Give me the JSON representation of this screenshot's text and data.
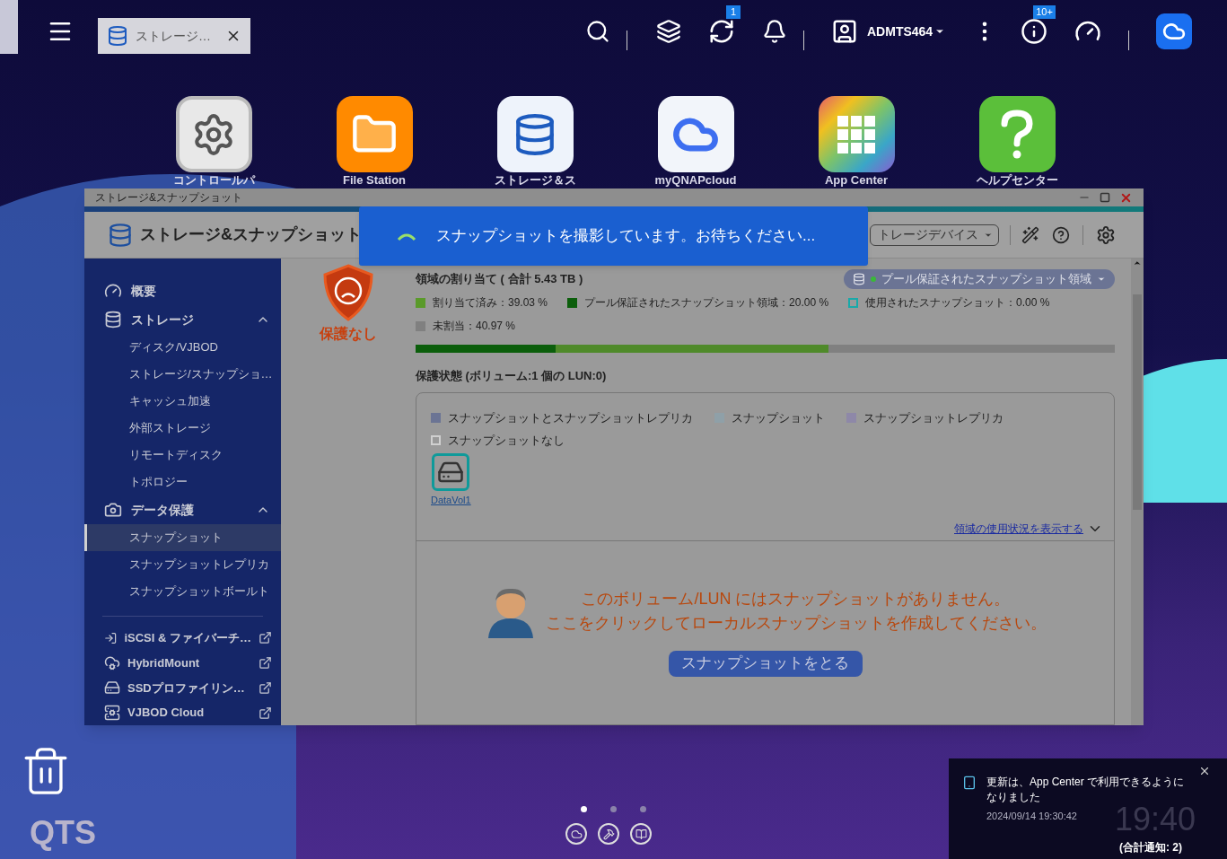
{
  "taskbar": {
    "tab": {
      "label": "ストレージ…"
    },
    "badges": [
      {
        "count": "1"
      },
      {
        "count": "10+"
      }
    ],
    "user": "ADMTS464"
  },
  "desktop_apps": [
    {
      "label": "コントロールパ"
    },
    {
      "label": "File Station"
    },
    {
      "label": "ストレージ＆ス"
    },
    {
      "label": "myQNAPcloud"
    },
    {
      "label": "App Center"
    },
    {
      "label": "ヘルプセンター"
    }
  ],
  "window": {
    "title": "ストレージ&スナップショット",
    "app_name": "ストレージ&スナップショット",
    "device_dropdown": "トレージデバイス"
  },
  "toast": {
    "message": "スナップショットを撮影しています。お待ちください..."
  },
  "sidebar": {
    "items": [
      {
        "label": "概要",
        "kind": "link"
      },
      {
        "label": "ストレージ",
        "kind": "section",
        "expanded": true,
        "children": [
          {
            "label": "ディスク/VJBOD",
            "selected": false
          },
          {
            "label": "ストレージ/スナップショ…",
            "selected": false
          },
          {
            "label": "キャッシュ加速",
            "selected": false
          },
          {
            "label": "外部ストレージ",
            "selected": false
          },
          {
            "label": "リモートディスク",
            "selected": false
          },
          {
            "label": "トポロジー",
            "selected": false
          }
        ]
      },
      {
        "label": "データ保護",
        "kind": "section",
        "expanded": true,
        "children": [
          {
            "label": "スナップショット",
            "selected": true
          },
          {
            "label": "スナップショットレプリカ",
            "selected": false
          },
          {
            "label": "スナップショットボールト",
            "selected": false
          }
        ]
      }
    ],
    "external": [
      {
        "label": "iSCSI & ファイバーチ…"
      },
      {
        "label": "HybridMount"
      },
      {
        "label": "SSDプロファイリン…"
      },
      {
        "label": "VJBOD Cloud"
      }
    ]
  },
  "status": {
    "label": "保護なし"
  },
  "allocation": {
    "title": "領域の割り当て ( 合計 5.43 TB )",
    "pool_button": "プール保証されたスナップショット領域",
    "legend": [
      {
        "label": "割り当て済み：39.03 %",
        "color": "#5a9a2a",
        "outlined": false
      },
      {
        "label": "プール保証されたスナップショット領域：20.00 %",
        "color": "#0b5e0b",
        "outlined": false
      },
      {
        "label": "使用されたスナップショット：0.00 %",
        "color": "#19a9a9",
        "outlined": true
      },
      {
        "label": "未割当：40.97 %",
        "color": "#808080",
        "outlined": false
      }
    ],
    "segments": [
      {
        "level": 0.2,
        "color": "#0b5e0b"
      },
      {
        "level": 0.3903,
        "color": "#4f8a2a"
      }
    ]
  },
  "protection": {
    "title": "保護状態 (ボリューム:1 個の LUN:0)",
    "legend": [
      {
        "label": "スナップショットとスナップショットレプリカ",
        "color": "#6b7494",
        "outlined": false
      },
      {
        "label": "スナップショット",
        "color": "#8fa0a8",
        "outlined": false
      },
      {
        "label": "スナップショットレプリカ",
        "color": "#8e88a8",
        "outlined": false
      },
      {
        "label": "スナップショットなし",
        "color": "#d0d0d0",
        "outlined": true
      }
    ],
    "volumes": [
      {
        "name": "DataVol1",
        "selected": true
      }
    ],
    "usage_link": "領域の使用状況を表示する",
    "message": [
      "このボリューム/LUN にはスナップショットがありません。",
      "ここをクリックしてローカルスナップショットを作成してください。"
    ],
    "button": "スナップショットをとる"
  },
  "desktop": {
    "logo": "QTS",
    "pages": [
      {
        "selected": true
      },
      {
        "selected": false
      },
      {
        "selected": false
      }
    ]
  },
  "notification": {
    "message": "更新は、App Center で利用できるようになりました",
    "time": "2024/09/14 19:30:42",
    "total": "(合計通知: 2)",
    "clock": "19:40"
  }
}
